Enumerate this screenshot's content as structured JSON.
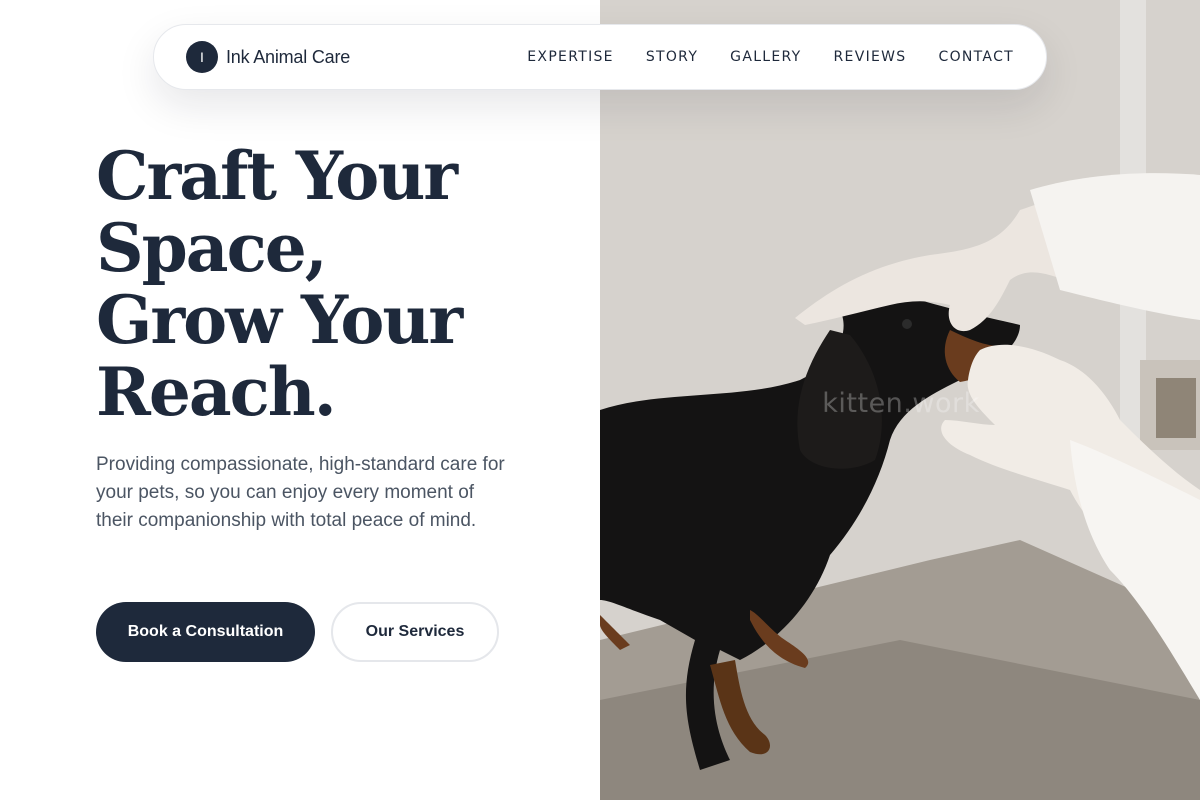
{
  "brand": {
    "initial": "I",
    "name": "Ink Animal Care"
  },
  "nav": {
    "links": [
      "EXPERTISE",
      "STORY",
      "GALLERY",
      "REVIEWS",
      "CONTACT"
    ]
  },
  "hero": {
    "title_lines": [
      "Craft Your",
      "Space,",
      "Grow Your",
      "Reach."
    ],
    "description": "Providing compassionate, high-standard care for your pets, so you can enjoy every moment of their companionship with total peace of mind.",
    "primary_button": "Book a Consultation",
    "secondary_button": "Our Services"
  },
  "photo": {
    "watermark": "kitten.work"
  },
  "colors": {
    "primary": "#1e293b",
    "body_text": "#4b5563",
    "background": "#ffffff"
  }
}
